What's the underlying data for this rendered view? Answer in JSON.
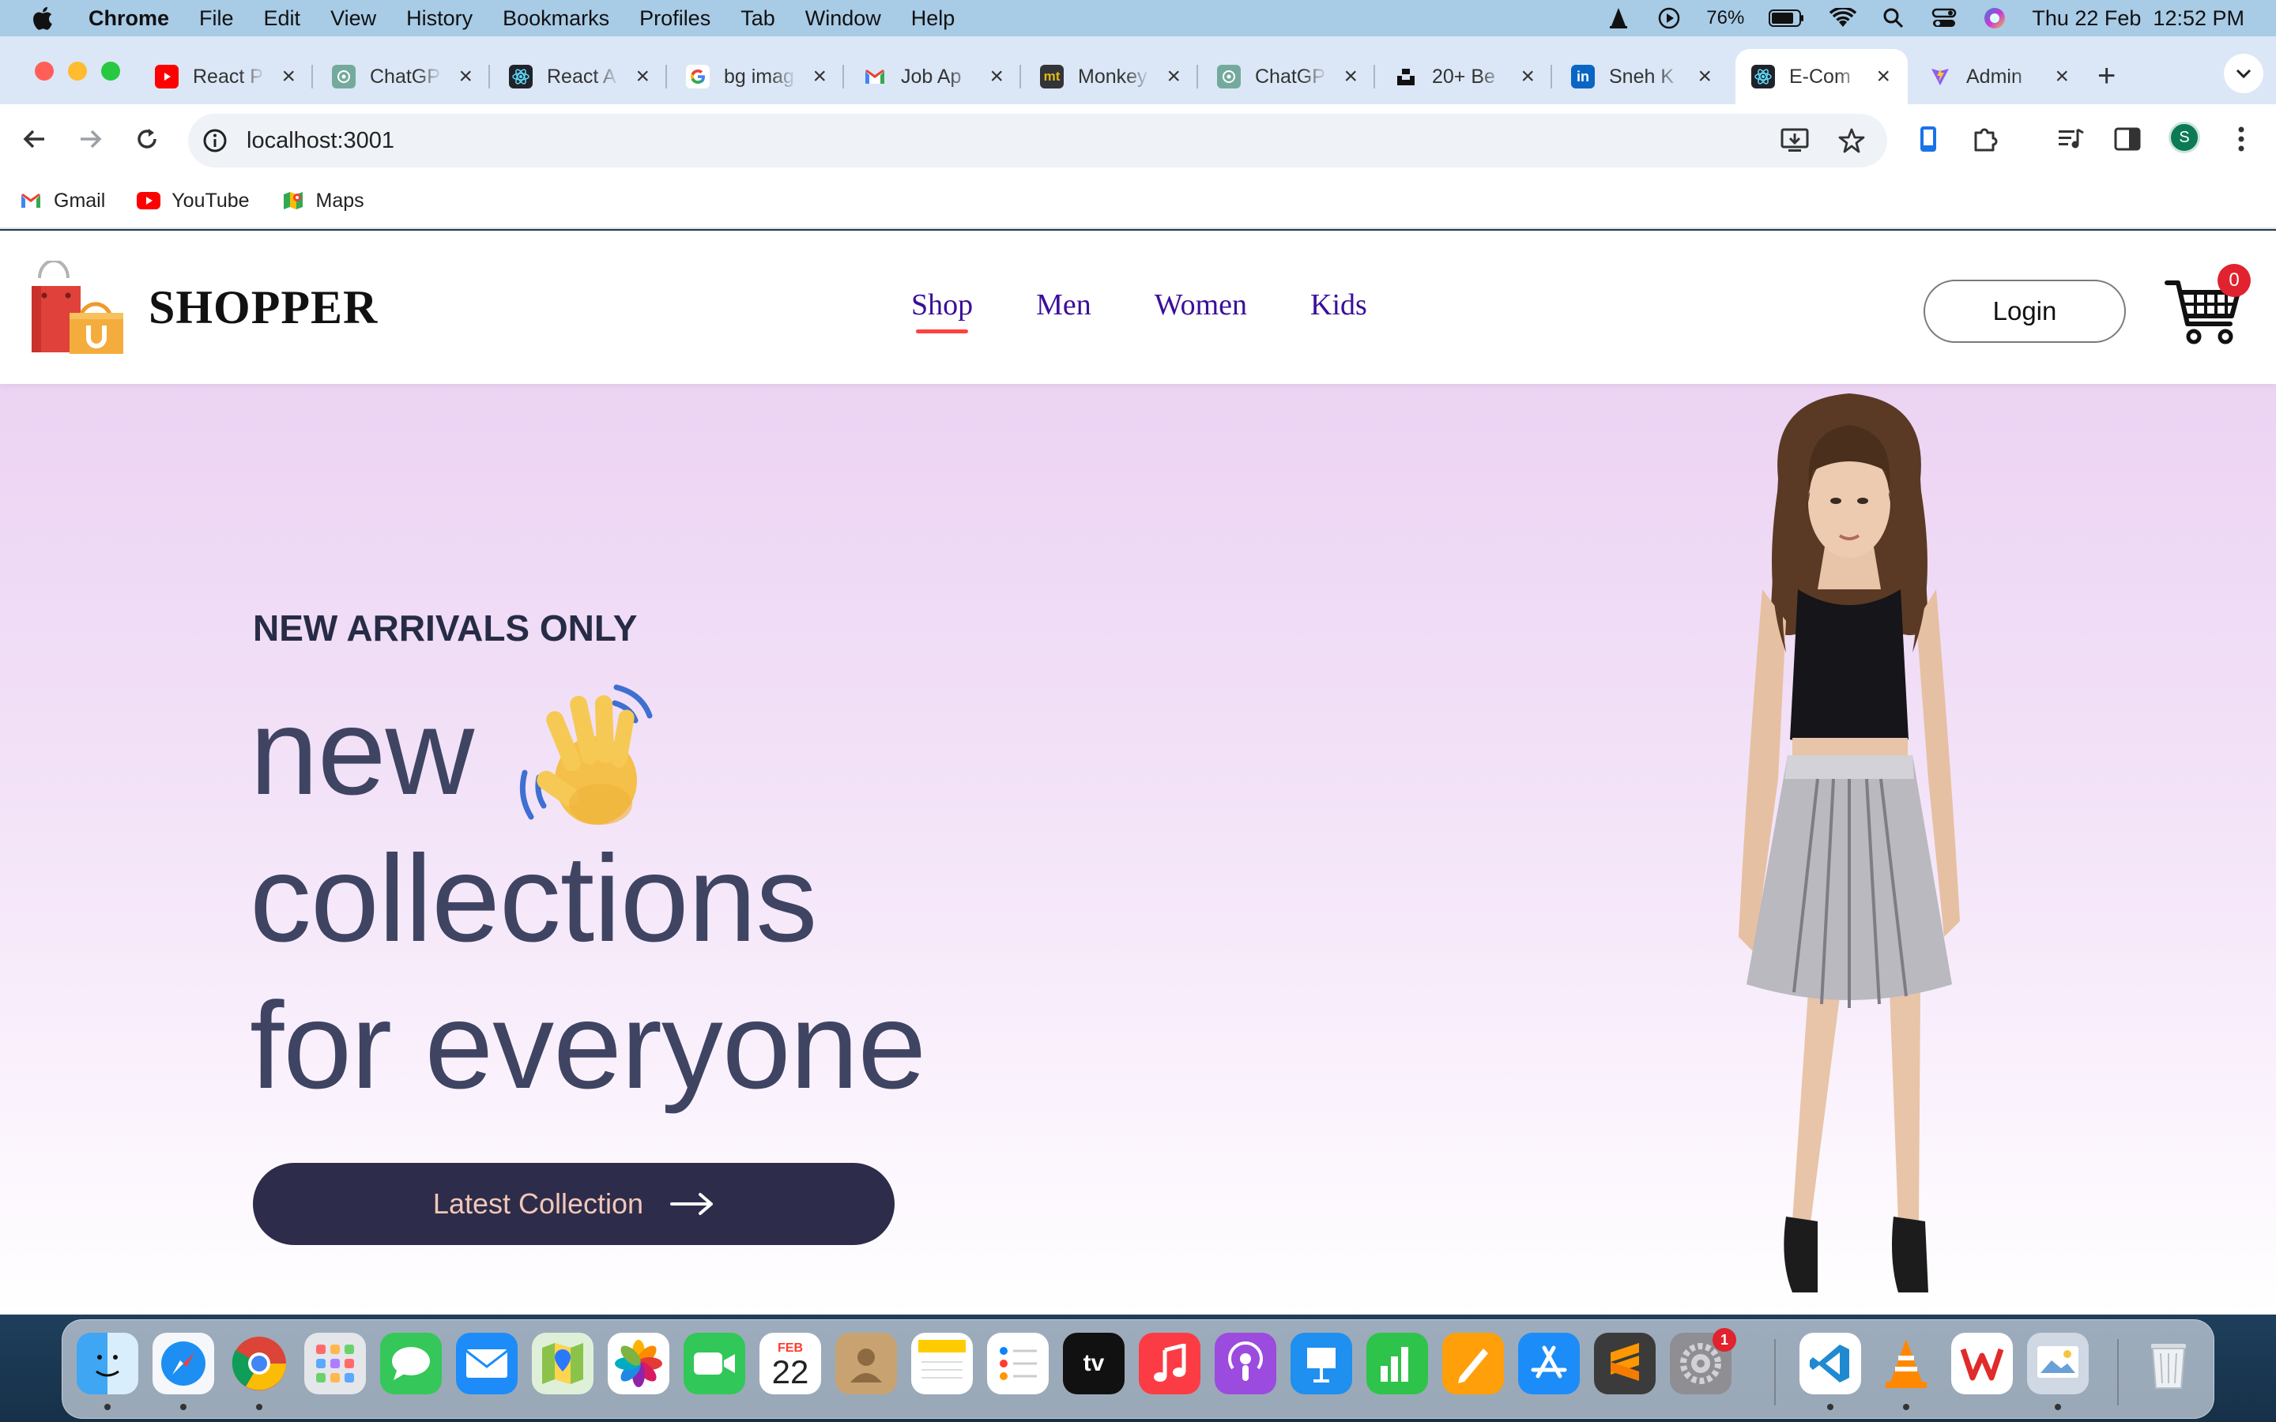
{
  "menubar": {
    "app_name": "Chrome",
    "items": [
      "File",
      "Edit",
      "View",
      "History",
      "Bookmarks",
      "Profiles",
      "Tab",
      "Window",
      "Help"
    ],
    "battery": "76%",
    "datetime": "Thu 22 Feb  12:52 PM"
  },
  "tabs": [
    {
      "title": "React P",
      "icon": "youtube-icon"
    },
    {
      "title": "ChatGP",
      "icon": "chatgpt-icon"
    },
    {
      "title": "React A",
      "icon": "react-icon"
    },
    {
      "title": "bg imag",
      "icon": "google-icon"
    },
    {
      "title": "Job Ap",
      "icon": "gmail-icon"
    },
    {
      "title": "Monkey",
      "icon": "monkeytype-icon"
    },
    {
      "title": "ChatGP",
      "icon": "chatgpt-icon"
    },
    {
      "title": "20+ Be",
      "icon": "unsplash-icon"
    },
    {
      "title": "Sneh K",
      "icon": "linkedin-icon"
    },
    {
      "title": "E-Com",
      "icon": "react-icon",
      "active": true
    },
    {
      "title": "Admin",
      "icon": "vite-icon"
    }
  ],
  "toolbar": {
    "url": "localhost:3001",
    "profile_initial": "S"
  },
  "bookmarks": [
    {
      "label": "Gmail",
      "icon": "gmail-icon"
    },
    {
      "label": "YouTube",
      "icon": "youtube-icon"
    },
    {
      "label": "Maps",
      "icon": "maps-icon"
    }
  ],
  "site": {
    "logo_text": "SHOPPER",
    "nav": [
      {
        "label": "Shop",
        "active": true
      },
      {
        "label": "Men"
      },
      {
        "label": "Women"
      },
      {
        "label": "Kids"
      }
    ],
    "login_label": "Login",
    "cart_count": "0"
  },
  "hero": {
    "kicker": "NEW ARRIVALS ONLY",
    "line1": "new",
    "line2": "collections",
    "line3": "for everyone",
    "cta_label": "Latest Collection"
  },
  "dock": {
    "calendar_month": "FEB",
    "calendar_day": "22",
    "settings_badge": "1",
    "appletv_label": "tv"
  },
  "colors": {
    "nav_link": "#3b0f9a",
    "nav_active_underline": "#ff4141",
    "cart_badge": "#e0232e",
    "hero_text": "#3f4462",
    "cta_bg": "#2d2c4a",
    "cta_text": "#f2c7b8"
  }
}
